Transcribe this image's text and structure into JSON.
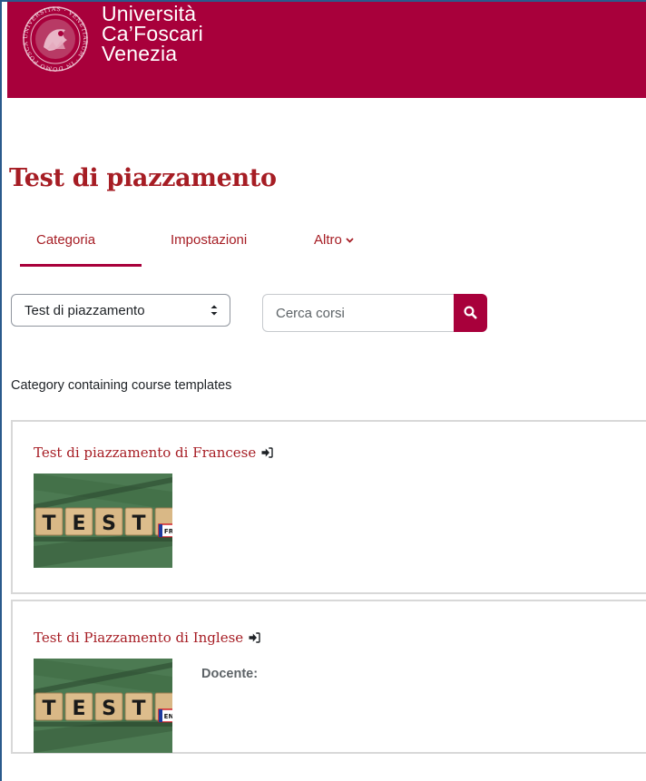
{
  "header": {
    "brand_line1": "Università",
    "brand_line2": "Ca’Foscari",
    "brand_line3": "Venezia",
    "seal_text": "UNIVERSITAS · VENETIARUM · IN DOMO FOSCARI"
  },
  "page": {
    "title": "Test di piazzamento"
  },
  "tabs": [
    {
      "label": "Categoria",
      "active": true
    },
    {
      "label": "Impostazioni",
      "active": false
    },
    {
      "label": "Altro",
      "active": false
    }
  ],
  "category_select": {
    "value": "Test di piazzamento"
  },
  "search": {
    "placeholder": "Cerca corsi"
  },
  "category_description": "Category containing course templates",
  "courses": [
    {
      "title": "Test di piazzamento di Francese",
      "image_text": "TEST",
      "badge": "FR"
    },
    {
      "title": "Test di Piazzamento di Inglese",
      "image_text": "TEST",
      "badge": "EN",
      "teacher_label": "Docente:"
    }
  ],
  "colors": {
    "brand": "#a8003b",
    "title_red": "#a61d24"
  }
}
